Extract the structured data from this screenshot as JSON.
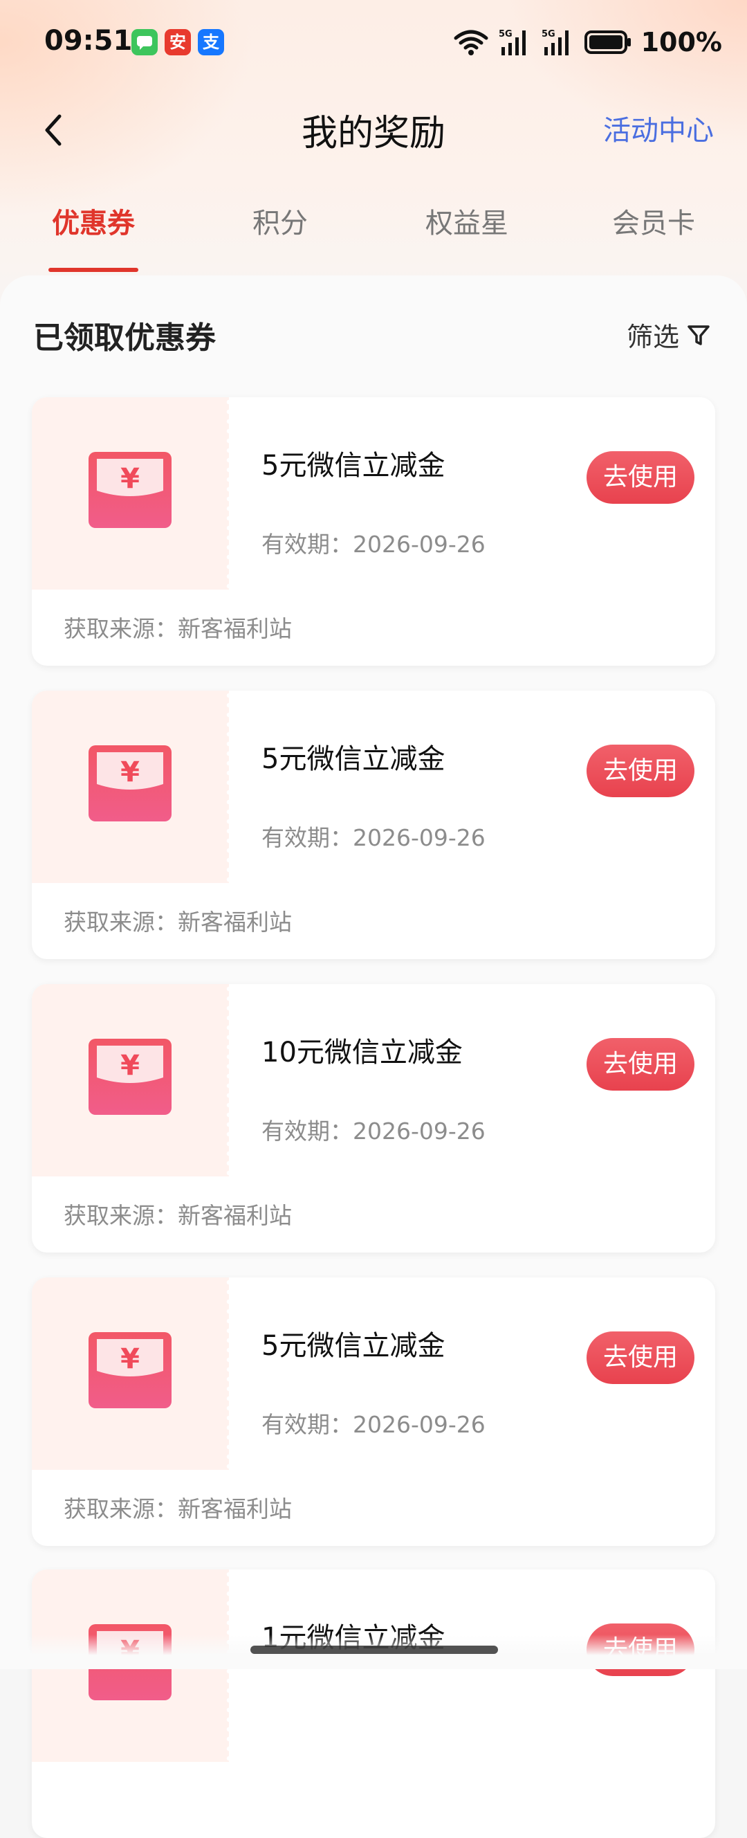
{
  "status_bar": {
    "time": "09:51",
    "battery_text": "100%",
    "app_icons": [
      {
        "name": "messages-icon",
        "glyph": "",
        "color": "#3dc55c"
      },
      {
        "name": "taobao-icon",
        "glyph": "安",
        "color": "#e83a2e"
      },
      {
        "name": "alipay-icon",
        "glyph": "支",
        "color": "#1677ff"
      }
    ],
    "network": [
      "5G",
      "5G"
    ]
  },
  "header": {
    "title": "我的奖励",
    "right_link": "活动中心"
  },
  "tabs": [
    {
      "label": "优惠券",
      "active": true
    },
    {
      "label": "积分",
      "active": false
    },
    {
      "label": "权益星",
      "active": false
    },
    {
      "label": "会员卡",
      "active": false
    }
  ],
  "section": {
    "title": "已领取优惠券",
    "filter_label": "筛选"
  },
  "coupons": [
    {
      "name": "5元微信立减金",
      "validity": "有效期：2026-09-26",
      "button": "去使用",
      "source": "获取来源：新客福利站"
    },
    {
      "name": "5元微信立减金",
      "validity": "有效期：2026-09-26",
      "button": "去使用",
      "source": "获取来源：新客福利站"
    },
    {
      "name": "10元微信立减金",
      "validity": "有效期：2026-09-26",
      "button": "去使用",
      "source": "获取来源：新客福利站"
    },
    {
      "name": "5元微信立减金",
      "validity": "有效期：2026-09-26",
      "button": "去使用",
      "source": "获取来源：新客福利站"
    },
    {
      "name": "1元微信立减金",
      "validity": "",
      "button": "去使用",
      "source": ""
    }
  ],
  "colors": {
    "accent": "#e0352b",
    "link": "#4a6ee0",
    "button": "#ec4a55"
  }
}
